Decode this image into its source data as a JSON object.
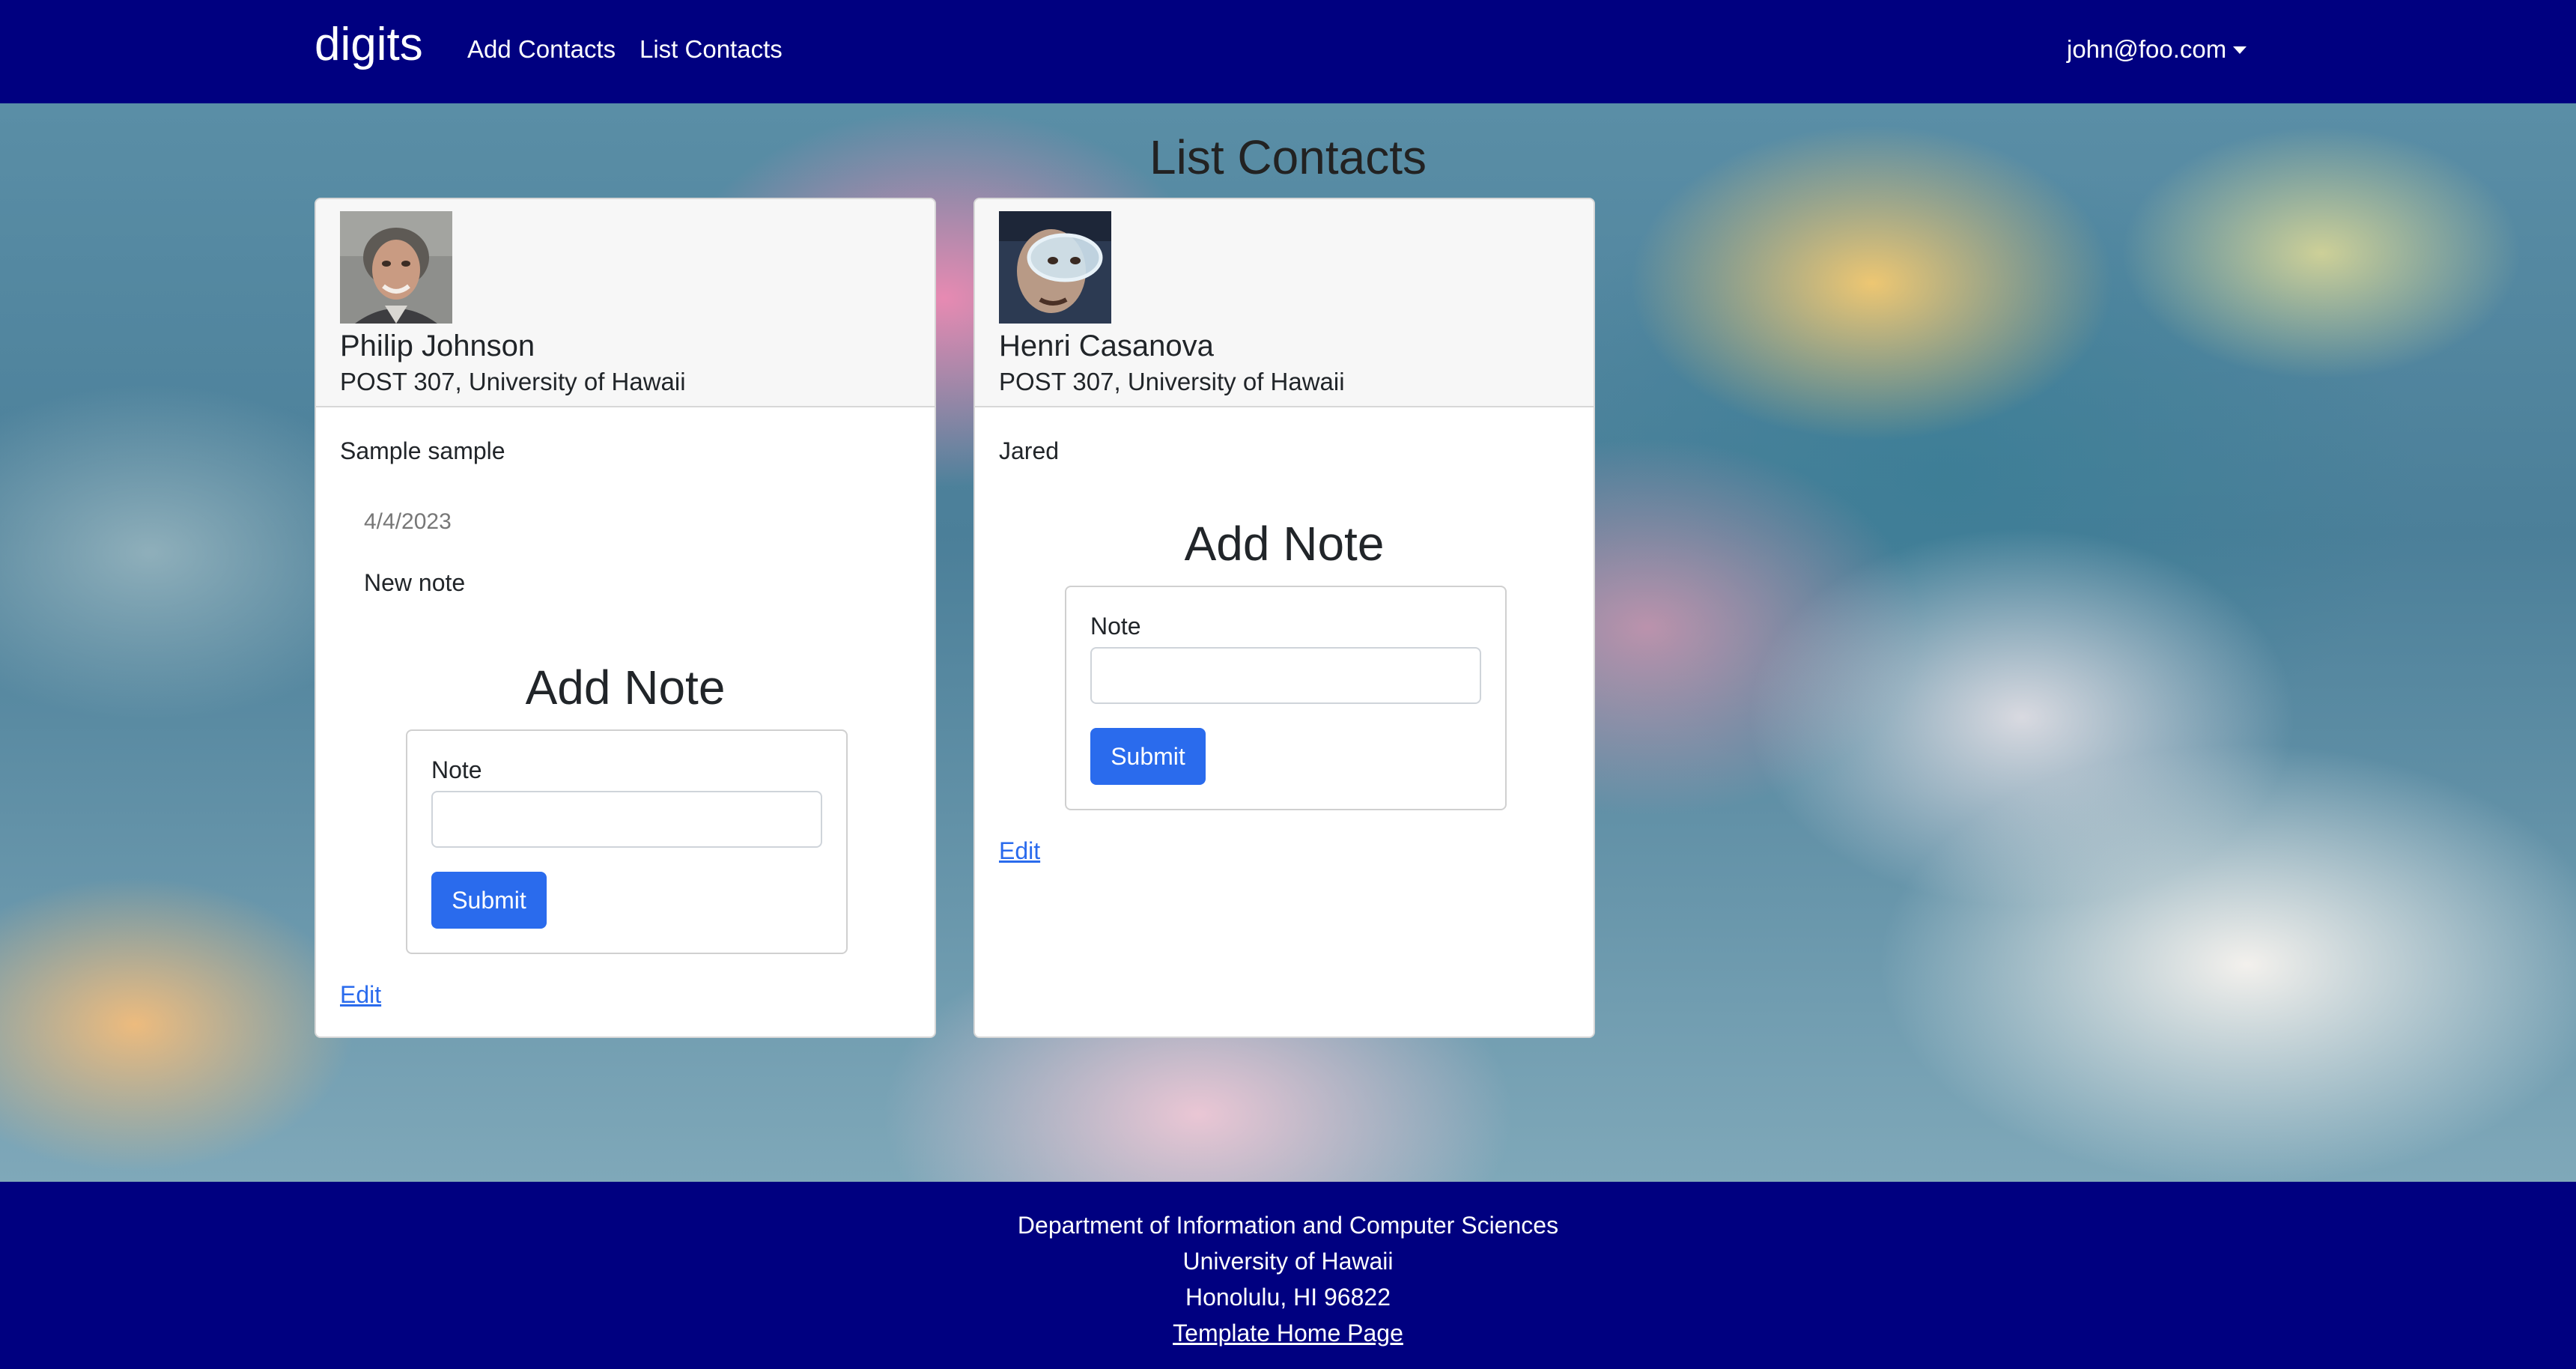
{
  "navbar": {
    "brand": "digits",
    "links": [
      "Add Contacts",
      "List Contacts"
    ],
    "user": "john@foo.com"
  },
  "main": {
    "title": "List Contacts"
  },
  "contacts": [
    {
      "name": "Philip Johnson",
      "address": "POST 307, University of Hawaii",
      "description": "Sample sample",
      "notes": [
        {
          "date": "4/4/2023",
          "text": "New note"
        }
      ],
      "add_note_title": "Add Note",
      "note_label": "Note",
      "note_value": "",
      "submit_label": "Submit",
      "edit_label": "Edit"
    },
    {
      "name": "Henri Casanova",
      "address": "POST 307, University of Hawaii",
      "description": "Jared",
      "notes": [],
      "add_note_title": "Add Note",
      "note_label": "Note",
      "note_value": "",
      "submit_label": "Submit",
      "edit_label": "Edit"
    }
  ],
  "footer": {
    "lines": [
      "Department of Information and Computer Sciences",
      "University of Hawaii",
      "Honolulu, HI 96822"
    ],
    "link": "Template Home Page"
  },
  "colors": {
    "navbar": "#000080",
    "primary": "#2a6bed"
  }
}
